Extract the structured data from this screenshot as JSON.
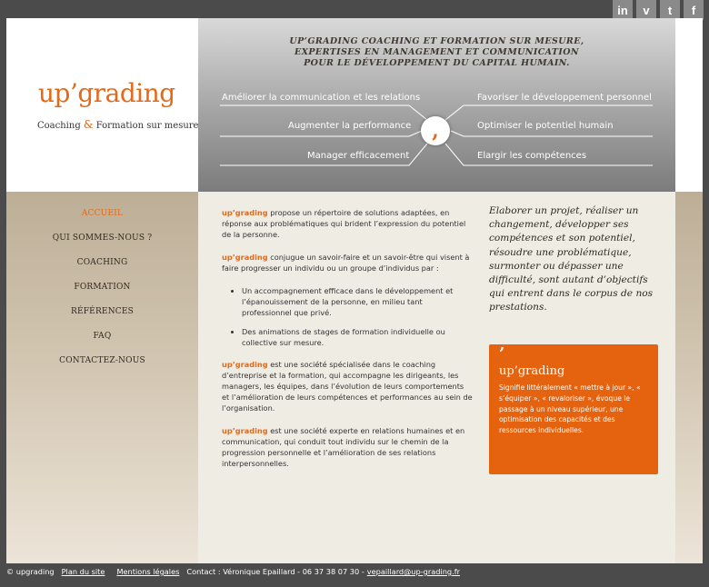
{
  "social": [
    {
      "icon": "linkedin-icon",
      "glyph": "in"
    },
    {
      "icon": "viadeo-icon",
      "glyph": "v"
    },
    {
      "icon": "twitter-icon",
      "glyph": "t"
    },
    {
      "icon": "facebook-icon",
      "glyph": "f"
    }
  ],
  "logo": {
    "title": "up’grading",
    "sub_a": "Coaching ",
    "sub_amp": "&",
    "sub_b": " Formation sur mesure"
  },
  "banner": {
    "tagline": [
      "UP’GRADING COACHING ET FORMATION SUR MESURE,",
      "EXPERTISES EN MANAGEMENT ET COMMUNICATION",
      "POUR LE DÉVELOPPEMENT DU CAPITAL HUMAIN."
    ],
    "left": [
      "Améliorer la communication et les relations",
      "Augmenter la performance",
      "Manager efficacement"
    ],
    "right": [
      "Favoriser le développement personnel",
      "Optimiser le potentiel humain",
      "Elargir les compétences"
    ],
    "center_mark": ","
  },
  "nav": [
    {
      "label": "ACCUEIL",
      "active": true
    },
    {
      "label": "QUI SOMMES-NOUS ?",
      "active": false
    },
    {
      "label": "COACHING",
      "active": false
    },
    {
      "label": "FORMATION",
      "active": false
    },
    {
      "label": "RÉFÉRENCES",
      "active": false
    },
    {
      "label": "FAQ",
      "active": false
    },
    {
      "label": "CONTACTEZ-NOUS",
      "active": false
    }
  ],
  "content": {
    "brand": "up’grading",
    "p1": " propose un répertoire de solutions adaptées, en réponse aux problématiques qui brident l’expression du potentiel de la personne.",
    "p2": " conjugue un savoir-faire et un savoir-être qui visent à faire progresser un individu ou un groupe d’individus par :",
    "bullets": [
      "Un accompagnement efficace dans le développement et l’épanouissement de la personne, en milieu tant professionnel que privé.",
      "Des animations de stages de formation individuelle ou collective sur mesure."
    ],
    "p3": " est une société spécialisée dans le coaching d’entreprise et la formation, qui accompagne les dirigeants, les managers, les équipes, dans l’évolution de leurs comportements et l’amélioration de leurs compétences et performances au sein de l’organisation.",
    "p4": " est une société experte en relations humaines et en communication, qui conduit tout individu sur le chemin de la progression personnelle et l’amélioration de ses relations interpersonnelles."
  },
  "quote": "Elaborer un projet, réaliser un changement, développer ses compétences et son potentiel, résoudre une problématique, surmonter ou dépasser une difficulté, sont autant d’objectifs qui entrent dans le corpus de nos prestations.",
  "card": {
    "mark": "’",
    "title": "up’grading",
    "text": "Signifie littéralement « mettre à jour », « s’équiper », « revaloriser », évoque le passage à un niveau supérieur, une optimisation des capacités et des ressources individuelles."
  },
  "footer": {
    "copyright": "© upgrading",
    "plan": "Plan du site",
    "mentions": "Mentions légales",
    "contact": "Contact : Véronique Epaillard - 06 37 38 07 30 -",
    "email": "vepaillard@up-grading.fr"
  },
  "colors": {
    "accent": "#e36a19",
    "card": "#e5630f",
    "background": "#4b4b4b"
  }
}
